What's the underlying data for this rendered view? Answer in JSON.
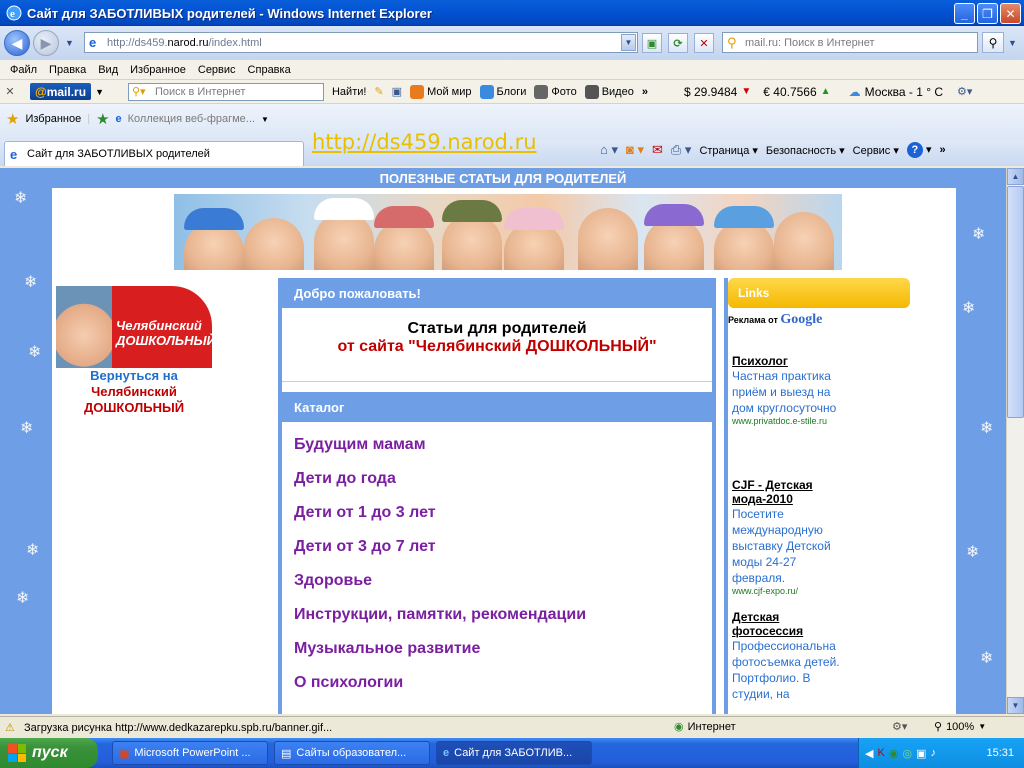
{
  "window": {
    "title": "Сайт для ЗАБОТЛИВЫХ родителей - Windows Internet Explorer"
  },
  "address": {
    "prefix": "http://ds459.",
    "domain": "narod.ru",
    "path": "/index.html"
  },
  "search": {
    "placeholder": "mail.ru: Поиск в Интернет"
  },
  "menu": [
    "Файл",
    "Правка",
    "Вид",
    "Избранное",
    "Сервис",
    "Справка"
  ],
  "mailbar": {
    "logo_at": "@",
    "logo_text": "mail.ru",
    "search_placeholder": "Поиск в Интернет",
    "find_label": "Найти!",
    "links": [
      "Мой мир",
      "Блоги",
      "Фото",
      "Видео"
    ],
    "usd": "$ 29.9484",
    "eur": "€ 40.7566",
    "weather": "Москва - 1 ° C"
  },
  "favbar": {
    "favorites": "Избранное",
    "collection": "Коллекция веб-фрагме..."
  },
  "tab": {
    "label": "Сайт для ЗАБОТЛИВЫХ родителей"
  },
  "overlay_url": "http://ds459.narod.ru",
  "cmdbar": {
    "page": "Страница",
    "security": "Безопасность",
    "service": "Сервис"
  },
  "page": {
    "header": "ПОЛЕЗНЫЕ СТАТЬИ ДЛЯ РОДИТЕЛЕЙ",
    "logo_line1": "Челябинский",
    "logo_line2": "ДОШКОЛЬНЫЙ",
    "back_l1": "Вернуться на",
    "back_l2": "Челябинский",
    "back_l3": "ДОШКОЛЬНЫЙ",
    "welcome_header": "Добро пожаловать!",
    "welcome_t1": "Статьи для родителей",
    "welcome_t2": "от сайта \"Челябинский ДОШКОЛЬНЫЙ\"",
    "catalog_header": "Каталог",
    "catalog": [
      "Будущим мамам",
      "Дети до года",
      "Дети от 1 до 3 лет",
      "Дети от 3 до 7 лет",
      "Здоровье",
      "Инструкции, памятки, рекомендации",
      "Музыкальное развитие",
      "О психологии"
    ],
    "links_header": "Links",
    "ads_label": "Реклама от",
    "ads_google": "Google",
    "ads": [
      {
        "title": "Психолог",
        "body": "Частная практика приём и выезд на дом круглосуточно",
        "url": "www.privatdoc.e-stile.ru"
      },
      {
        "title": "CJF - Детская мода-2010",
        "body": "Посетите международную выставку Детской моды 24-27 февраля.",
        "url": "www.cjf-expo.ru/"
      },
      {
        "title": "Детская фотосессия",
        "body": "Профессиональна фотосъемка детей. Портфолио. В студии, на",
        "url": ""
      }
    ]
  },
  "status": {
    "text": "Загрузка рисунка http://www.dedkazarepku.spb.ru/banner.gif...",
    "zone": "Интернет",
    "zoom": "100%"
  },
  "taskbar": {
    "start": "пуск",
    "tasks": [
      "Microsoft PowerPoint ...",
      "Сайты образовател...",
      "Сайт для ЗАБОТЛИВ..."
    ],
    "lang": "RU",
    "clock": "15:31"
  }
}
